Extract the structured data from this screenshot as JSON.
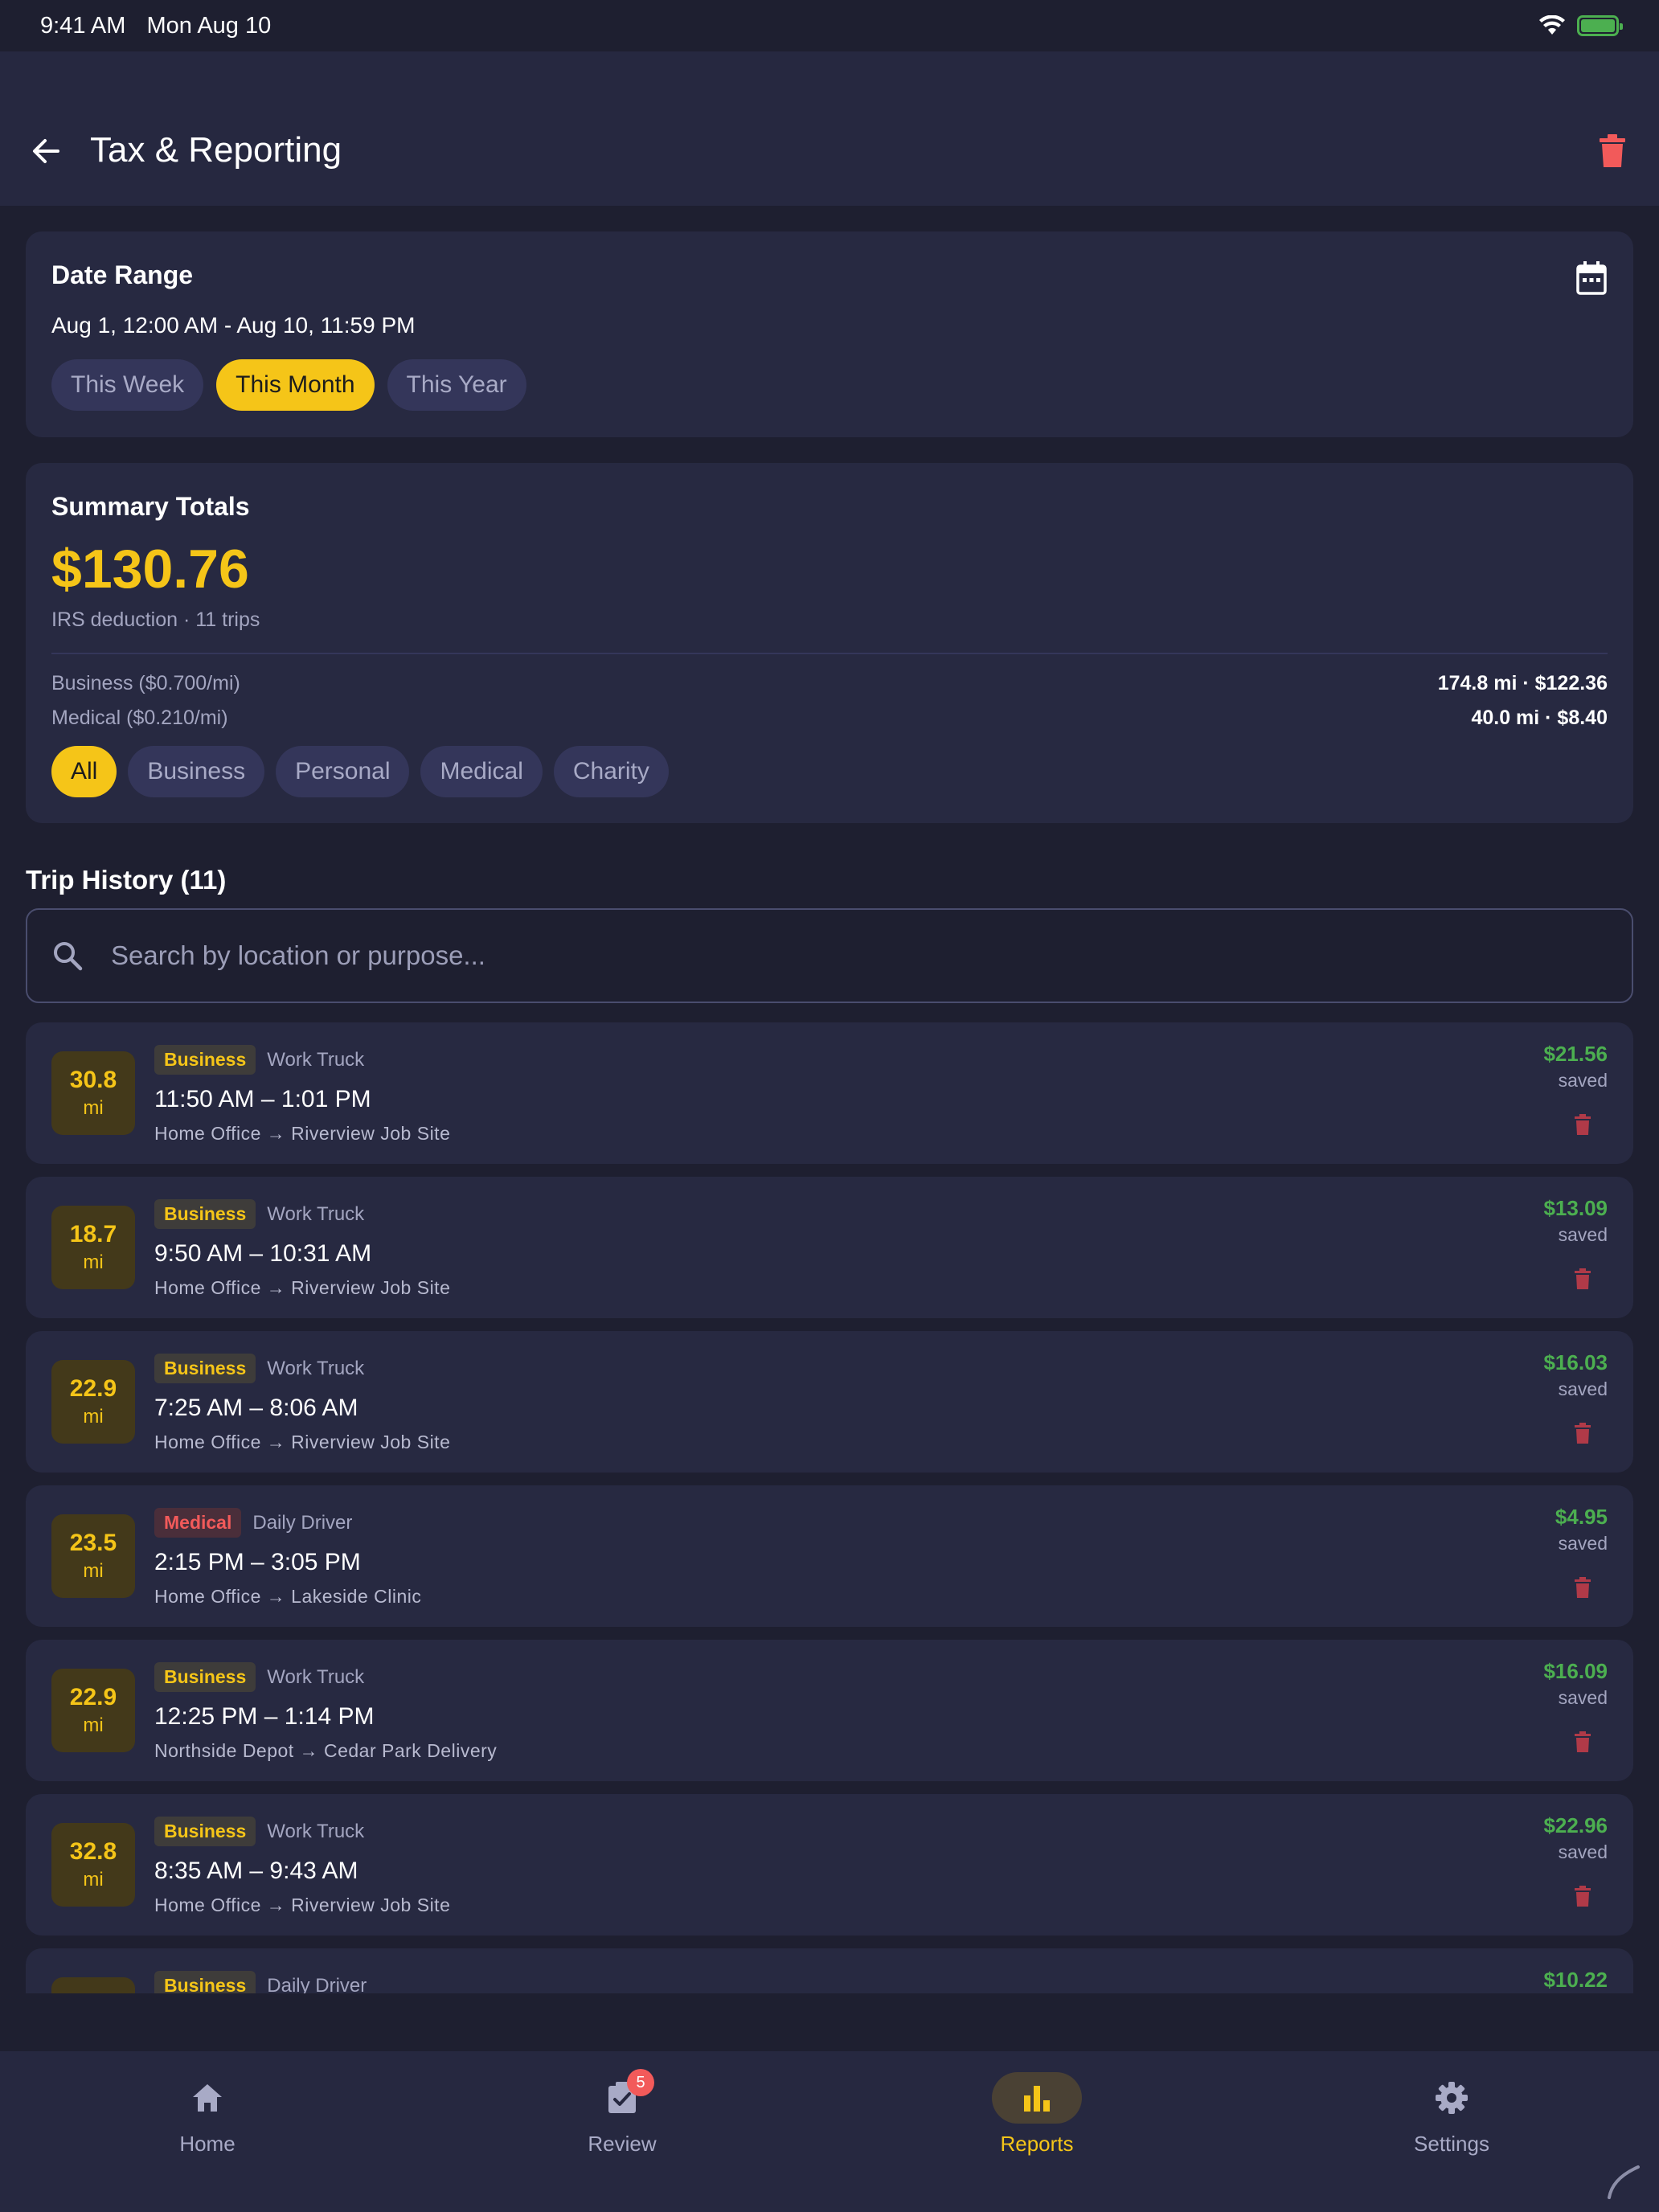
{
  "status_bar": {
    "time": "9:41 AM",
    "date": "Mon Aug 10"
  },
  "app_bar": {
    "title": "Tax & Reporting"
  },
  "date_range": {
    "heading": "Date Range",
    "value": "Aug 1, 12:00 AM - Aug 10, 11:59 PM",
    "presets": [
      "This Week",
      "This Month",
      "This Year"
    ],
    "selected_preset": "This Month"
  },
  "summary": {
    "heading": "Summary Totals",
    "total": "$130.76",
    "subtitle": "IRS deduction · 11 trips",
    "rates": [
      {
        "label": "Business ($0.700/mi)",
        "value": "174.8 mi · $122.36"
      },
      {
        "label": "Medical ($0.210/mi)",
        "value": "40.0 mi · $8.40"
      }
    ],
    "filters": [
      "All",
      "Business",
      "Personal",
      "Medical",
      "Charity"
    ],
    "selected_filter": "All"
  },
  "trip_history": {
    "title": "Trip History (11)",
    "search_placeholder": "Search by location or purpose...",
    "unit": "mi",
    "saved_label": "saved",
    "trips": [
      {
        "miles": "30.8",
        "category": "Business",
        "vehicle": "Work Truck",
        "time": "11:50 AM – 1:01 PM",
        "route": "Home Office → Riverview Job Site",
        "saved": "$21.56"
      },
      {
        "miles": "18.7",
        "category": "Business",
        "vehicle": "Work Truck",
        "time": "9:50 AM – 10:31 AM",
        "route": "Home Office → Riverview Job Site",
        "saved": "$13.09"
      },
      {
        "miles": "22.9",
        "category": "Business",
        "vehicle": "Work Truck",
        "time": "7:25 AM – 8:06 AM",
        "route": "Home Office → Riverview Job Site",
        "saved": "$16.03"
      },
      {
        "miles": "23.5",
        "category": "Medical",
        "vehicle": "Daily Driver",
        "time": "2:15 PM – 3:05 PM",
        "route": "Home Office → Lakeside Clinic",
        "saved": "$4.95"
      },
      {
        "miles": "22.9",
        "category": "Business",
        "vehicle": "Work Truck",
        "time": "12:25 PM – 1:14 PM",
        "route": "Northside Depot → Cedar Park Delivery",
        "saved": "$16.09"
      },
      {
        "miles": "32.8",
        "category": "Business",
        "vehicle": "Work Truck",
        "time": "8:35 AM – 9:43 AM",
        "route": "Home Office → Riverview Job Site",
        "saved": "$22.96"
      },
      {
        "miles": "",
        "category": "Business",
        "vehicle": "Daily Driver",
        "time": "",
        "route": "",
        "saved": "$10.22"
      }
    ]
  },
  "bottom_nav": {
    "items": [
      {
        "label": "Home",
        "icon": "home-icon"
      },
      {
        "label": "Review",
        "icon": "review-icon",
        "badge": "5"
      },
      {
        "label": "Reports",
        "icon": "bar-chart-icon"
      },
      {
        "label": "Settings",
        "icon": "gear-icon"
      }
    ],
    "active": "Reports"
  },
  "colors": {
    "background": "#1e1f30",
    "card": "#272941",
    "accent": "#f5c518",
    "saved_green": "#4caf50",
    "danger": "#f25a5a"
  }
}
